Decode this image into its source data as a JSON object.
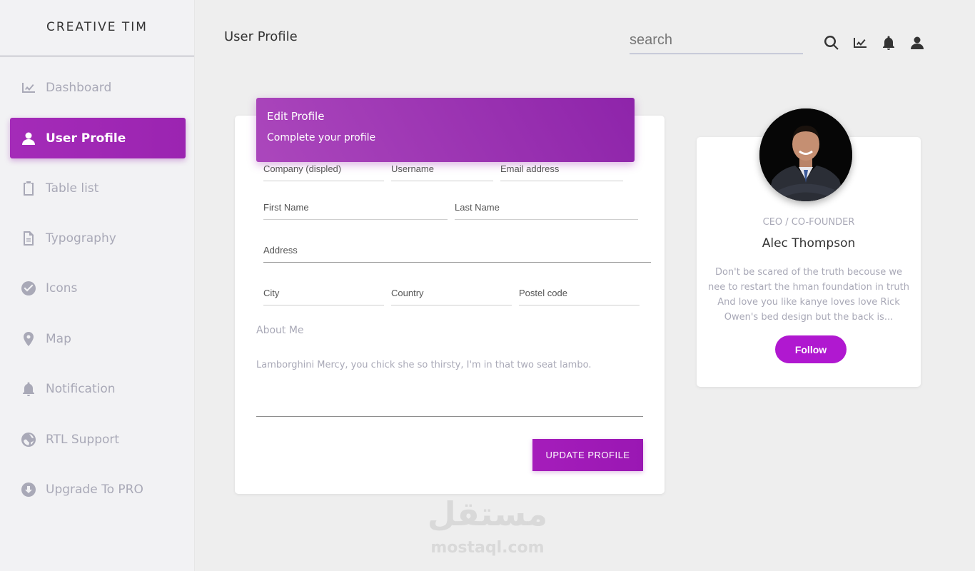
{
  "brand": "CREATIVE TIM",
  "sidebar": {
    "items": [
      {
        "label": "Dashboard",
        "icon": "chart-icon"
      },
      {
        "label": "User Profile",
        "icon": "person-icon",
        "active": true
      },
      {
        "label": "Table list",
        "icon": "clipboard-icon"
      },
      {
        "label": "Typography",
        "icon": "document-icon"
      },
      {
        "label": "Icons",
        "icon": "check-circle-icon"
      },
      {
        "label": "Map",
        "icon": "map-pin-icon"
      },
      {
        "label": "Notification",
        "icon": "bell-icon"
      },
      {
        "label": "RTL Support",
        "icon": "language-icon"
      },
      {
        "label": "Upgrade To PRO",
        "icon": "download-icon"
      }
    ]
  },
  "header": {
    "title": "User Profile",
    "search_placeholder": "search",
    "icons": [
      "search-icon",
      "chart-icon",
      "bell-icon",
      "person-icon"
    ]
  },
  "edit_profile": {
    "title": "Edit Profile",
    "subtitle": "Complete your profile",
    "fields": {
      "company": "Company (displed)",
      "username": "Username",
      "email": "Email address",
      "first_name": "First Name",
      "last_name": "Last Name",
      "address": "Address",
      "city": "City",
      "country": "Country",
      "postal": "Postel code"
    },
    "about_label": "About Me",
    "about_text": "Lamborghini Mercy, you chick she so thirsty, I'm in that two seat lambo.",
    "update_label": "UPDATE PROFILE"
  },
  "profile": {
    "role": "CEO / CO-FOUNDER",
    "name": "Alec Thompson",
    "bio": "Don't be scared of the truth becouse we nee to restart the hman foundation in truth And love you like kanye loves love Rick Owen's bed design but the back is...",
    "follow_label": "Follow"
  },
  "watermark": {
    "arabic": "مستقل",
    "latin": "mostaql.com"
  },
  "colors": {
    "accent": "#9c27b0",
    "follow": "#b018d0",
    "muted": "#a9a9b7"
  }
}
